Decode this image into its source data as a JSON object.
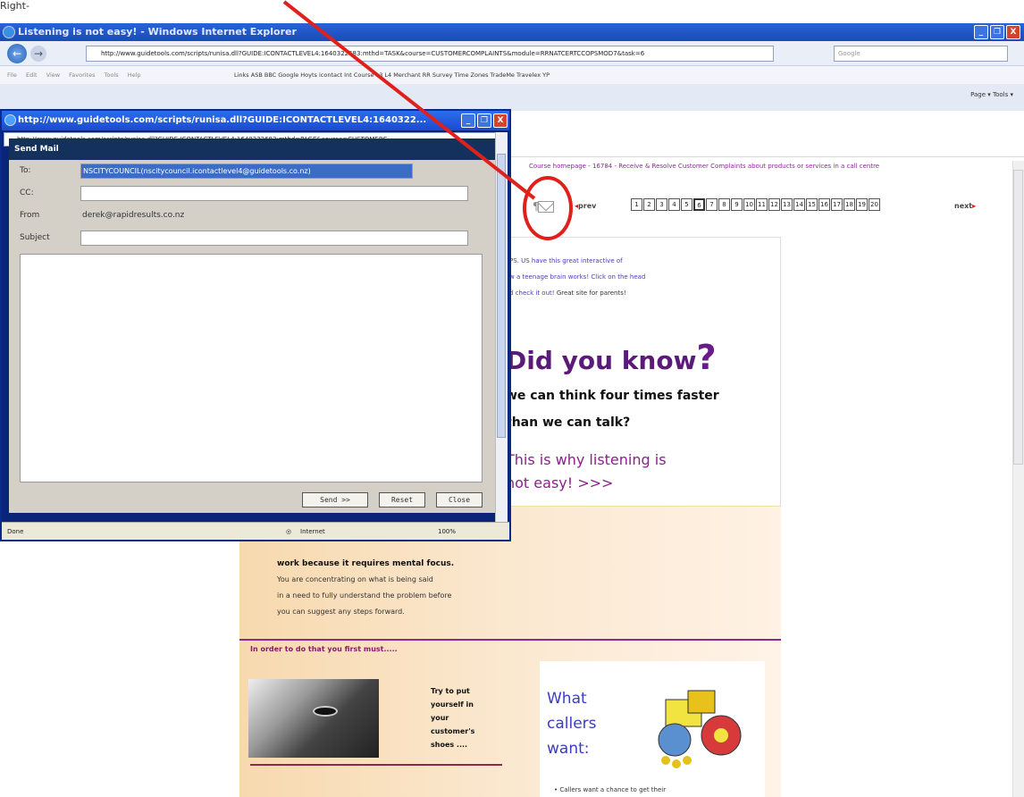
{
  "top_stripe": "Right-",
  "window": {
    "title": "Listening is not easy! - Windows Internet Explorer",
    "min": "_",
    "max": "❐",
    "close": "X"
  },
  "nav": {
    "back": "←",
    "forward": "→",
    "address": "http://www.guidetools.com/scripts/runisa.dll?GUIDE:ICONTACTLEVEL4:1640322683:mthd=TASK&course=CUSTOMERCOMPLAINTS&module=RRNATCERTCCOPSMOD7&task=6",
    "search_placeholder": "Google"
  },
  "menubar": {
    "items": [
      "File",
      "Edit",
      "View",
      "Favorites",
      "Tools",
      "Help"
    ],
    "links": "Links  ASB  BBC  Google  Hoyts  icontact  Int Course  L3  L4  Merchant  RR  Survey  Time Zones  TradeMe  Travelex  YP"
  },
  "cmdbar": {
    "text": "Page ▾   Tools ▾"
  },
  "page": {
    "crumb": "Course homepage - 16784 - Receive & Resolve Customer Complaints about products or services in a call centre",
    "prev": "prev",
    "next": "next",
    "pages": [
      "1",
      "2",
      "3",
      "4",
      "5",
      "6",
      "7",
      "8",
      "9",
      "10",
      "11",
      "12",
      "13",
      "14",
      "15",
      "16",
      "17",
      "18",
      "19",
      "20"
    ],
    "current_page": "6",
    "info_lines": [
      "PS. US have this great interactive of",
      "w a teenage brain works! Click on the head",
      "d check it out!"
    ],
    "info_plain": "Great site for parents!",
    "did_you_know": "Did you know",
    "q": "?",
    "think1": "we can think four times faster",
    "think2": "than we can talk?",
    "listen1": "This is why listening is",
    "listen2": "not easy! >>>",
    "peach_bold": "work because it requires mental focus.",
    "peach_l1": "You are concentrating on what is being said",
    "peach_l2": "in a need to fully understand the problem before",
    "peach_l3": "you can suggest any steps forward.",
    "order": "In order to do that you first must.....",
    "try": [
      "Try to put",
      "yourself in",
      "your",
      "customer's",
      "shoes ...."
    ],
    "what": [
      "What",
      "callers",
      "want:"
    ],
    "callers_bullet": "Callers want a chance to get their"
  },
  "popup": {
    "title": "http://www.guidetools.com/scripts/runisa.dll?GUIDE:ICONTACTLEVEL4:1640322...",
    "address": "http://www.guidetools.com/scripts/runisa.dll?GUIDE:ICONTACTLEVEL4:1640322683:mthd=PAGE&course=CUSTOMERC",
    "heading": "Send Mail",
    "to_label": "To:",
    "to_value": "NSCITYCOUNCIL(nscitycouncil.icontactlevel4@guidetools.co.nz)",
    "cc_label": "CC:",
    "from_label": "From",
    "from_value": "derek@rapidresults.co.nz",
    "subject_label": "Subject",
    "send": "Send >>",
    "reset": "Reset",
    "close": "Close",
    "status_done": "Done",
    "status_zone": "Internet",
    "status_zoom": "100%"
  },
  "colors": {
    "annotation_red": "#e0211b",
    "title_purple": "#5a1a78",
    "link_blue": "#4b3ac4"
  }
}
